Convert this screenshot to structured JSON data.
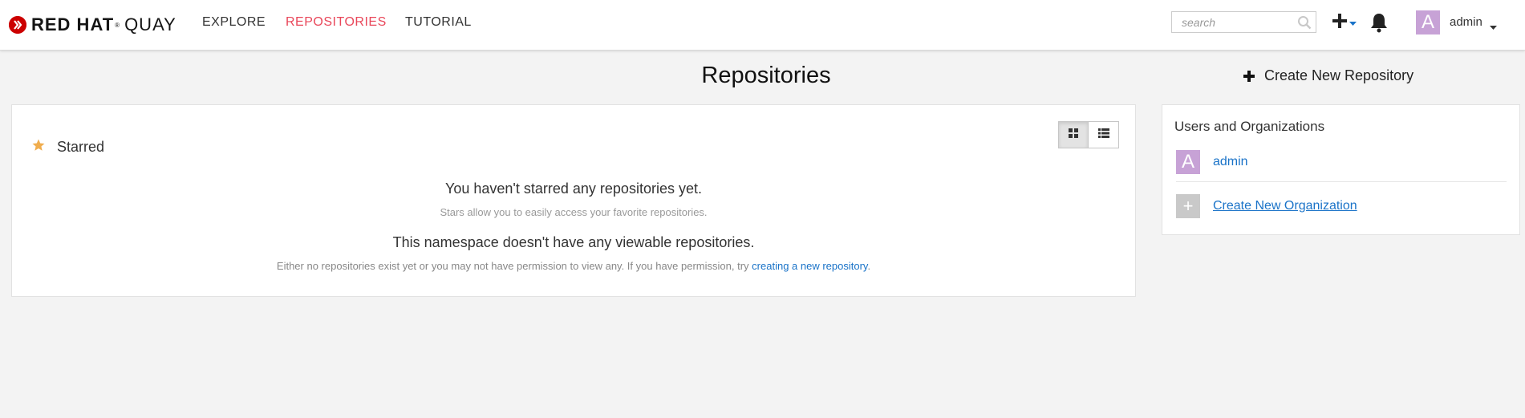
{
  "brand": {
    "bold": "RED HAT",
    "reg": "®",
    "light": "QUAY"
  },
  "nav": {
    "explore": "EXPLORE",
    "repositories": "REPOSITORIES",
    "tutorial": "TUTORIAL"
  },
  "search": {
    "placeholder": "search",
    "value": ""
  },
  "user": {
    "avatar_letter": "A",
    "name": "admin"
  },
  "main": {
    "title": "Repositories",
    "create_repo": "Create New Repository",
    "starred_label": "Starred",
    "no_starred": "You haven't starred any repositories yet.",
    "stars_help": "Stars allow you to easily access your favorite repositories.",
    "no_repos": "This namespace doesn't have any viewable repositories.",
    "no_repos_help": "Either no repositories exist yet or you may not have permission to view any. If you have permission, try",
    "create_link": "creating a new repository",
    "period": "."
  },
  "orgs": {
    "title": "Users and Organizations",
    "items": [
      {
        "avatar": "A",
        "label": "admin"
      },
      {
        "avatar": "+",
        "label": "Create New Organization"
      }
    ]
  },
  "colors": {
    "accent_red": "#e9475a",
    "link_blue": "#1a73c8",
    "avatar_purple": "#c7a2d6",
    "star_orange": "#f0ad4e"
  },
  "icons": {
    "brand": "redhat-logo-icon",
    "search": "search-icon",
    "create": "plus-icon",
    "notifications": "bell-icon",
    "starred": "star-icon",
    "grid_view": "grid-view-icon",
    "list_view": "list-view-icon"
  }
}
